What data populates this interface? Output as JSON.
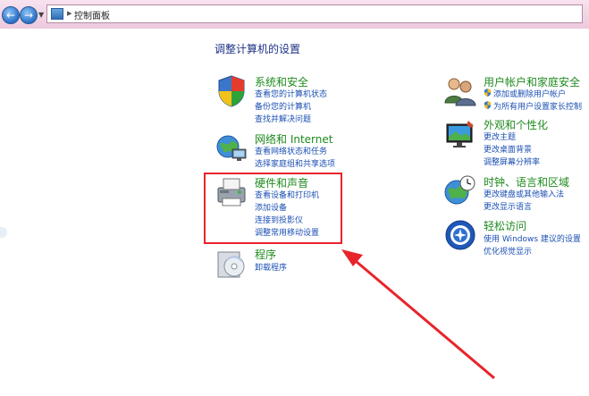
{
  "address": {
    "path": "控制面板"
  },
  "page_title": "调整计算机的设置",
  "categories": {
    "security": {
      "title": "系统和安全",
      "links": [
        "查看您的计算机状态",
        "备份您的计算机",
        "查找并解决问题"
      ]
    },
    "network": {
      "title": "网络和 Internet",
      "links": [
        "查看网络状态和任务",
        "选择家庭组和共享选项"
      ]
    },
    "hardware": {
      "title": "硬件和声音",
      "links": [
        "查看设备和打印机",
        "添加设备",
        "连接到投影仪",
        "调整常用移动设置"
      ]
    },
    "programs": {
      "title": "程序",
      "links": [
        "卸载程序"
      ]
    },
    "users": {
      "title": "用户帐户和家庭安全",
      "links": [
        "添加或删除用户帐户",
        "为所有用户设置家长控制"
      ]
    },
    "appearance": {
      "title": "外观和个性化",
      "links": [
        "更改主题",
        "更改桌面背景",
        "调整屏幕分辨率"
      ]
    },
    "clock": {
      "title": "时钟、语言和区域",
      "links": [
        "更改键盘或其他输入法",
        "更改显示语言"
      ]
    },
    "access": {
      "title": "轻松访问",
      "links": [
        "使用 Windows 建议的设置",
        "优化视觉显示"
      ]
    }
  },
  "colors": {
    "annotation": "#e8242b",
    "link": "#1b4fb3",
    "category_title": "#1f8a1f",
    "heading": "#1e3287"
  },
  "icons": {
    "back": "back-arrow-icon",
    "forward": "forward-arrow-icon",
    "control_panel": "control-panel-icon"
  }
}
